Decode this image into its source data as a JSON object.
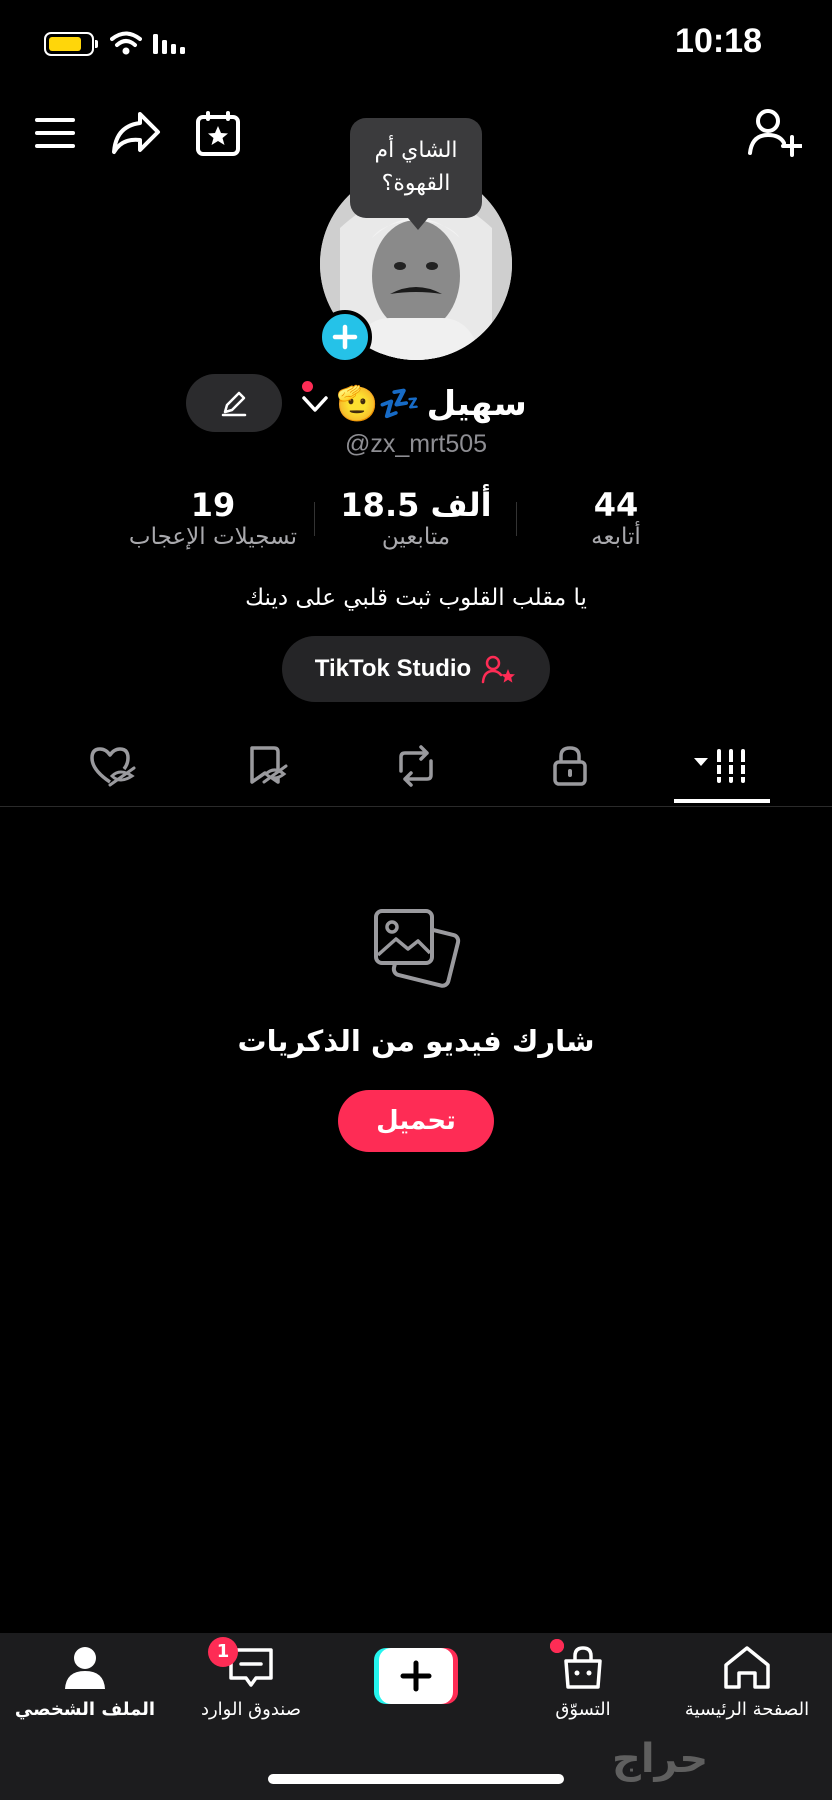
{
  "status_bar": {
    "time": "10:18"
  },
  "header": {
    "menu_icon": "hamburger-icon",
    "share_icon": "share-arrow-icon",
    "calendar_icon": "calendar-star-icon",
    "add_friend_icon": "add-user-icon"
  },
  "profile": {
    "tooltip_line1": "الشاي أم",
    "tooltip_line2": "القهوة؟",
    "display_name": "سهيل",
    "name_emoji": "🫡💤",
    "handle": "@zx_mrt505",
    "bio": "يا مقلب القلوب ثبت قلبي على دينك"
  },
  "stats": [
    {
      "value": "44",
      "label": "أتابعه"
    },
    {
      "value": "18.5 ألف",
      "label": "متابعين"
    },
    {
      "value": "19",
      "label": "تسجيلات الإعجاب"
    }
  ],
  "studio_button": {
    "label": "TikTok Studio"
  },
  "content_tabs": [
    "videos-grid-icon",
    "lock-icon",
    "repost-icon",
    "bookmark-hidden-icon",
    "liked-hidden-icon"
  ],
  "empty_state": {
    "title": "شارك فيديو من الذكريات",
    "button_label": "تحميل"
  },
  "bottom_nav": {
    "home": "الصفحة الرئيسية",
    "shop": "التسوّق",
    "inbox": "صندوق الوارد",
    "inbox_badge": "1",
    "profile": "الملف الشخصي"
  },
  "watermark": "حراج",
  "colors": {
    "accent": "#fe2c55",
    "badge_blue": "#25c2e8",
    "surface": "#2b2b2d"
  }
}
